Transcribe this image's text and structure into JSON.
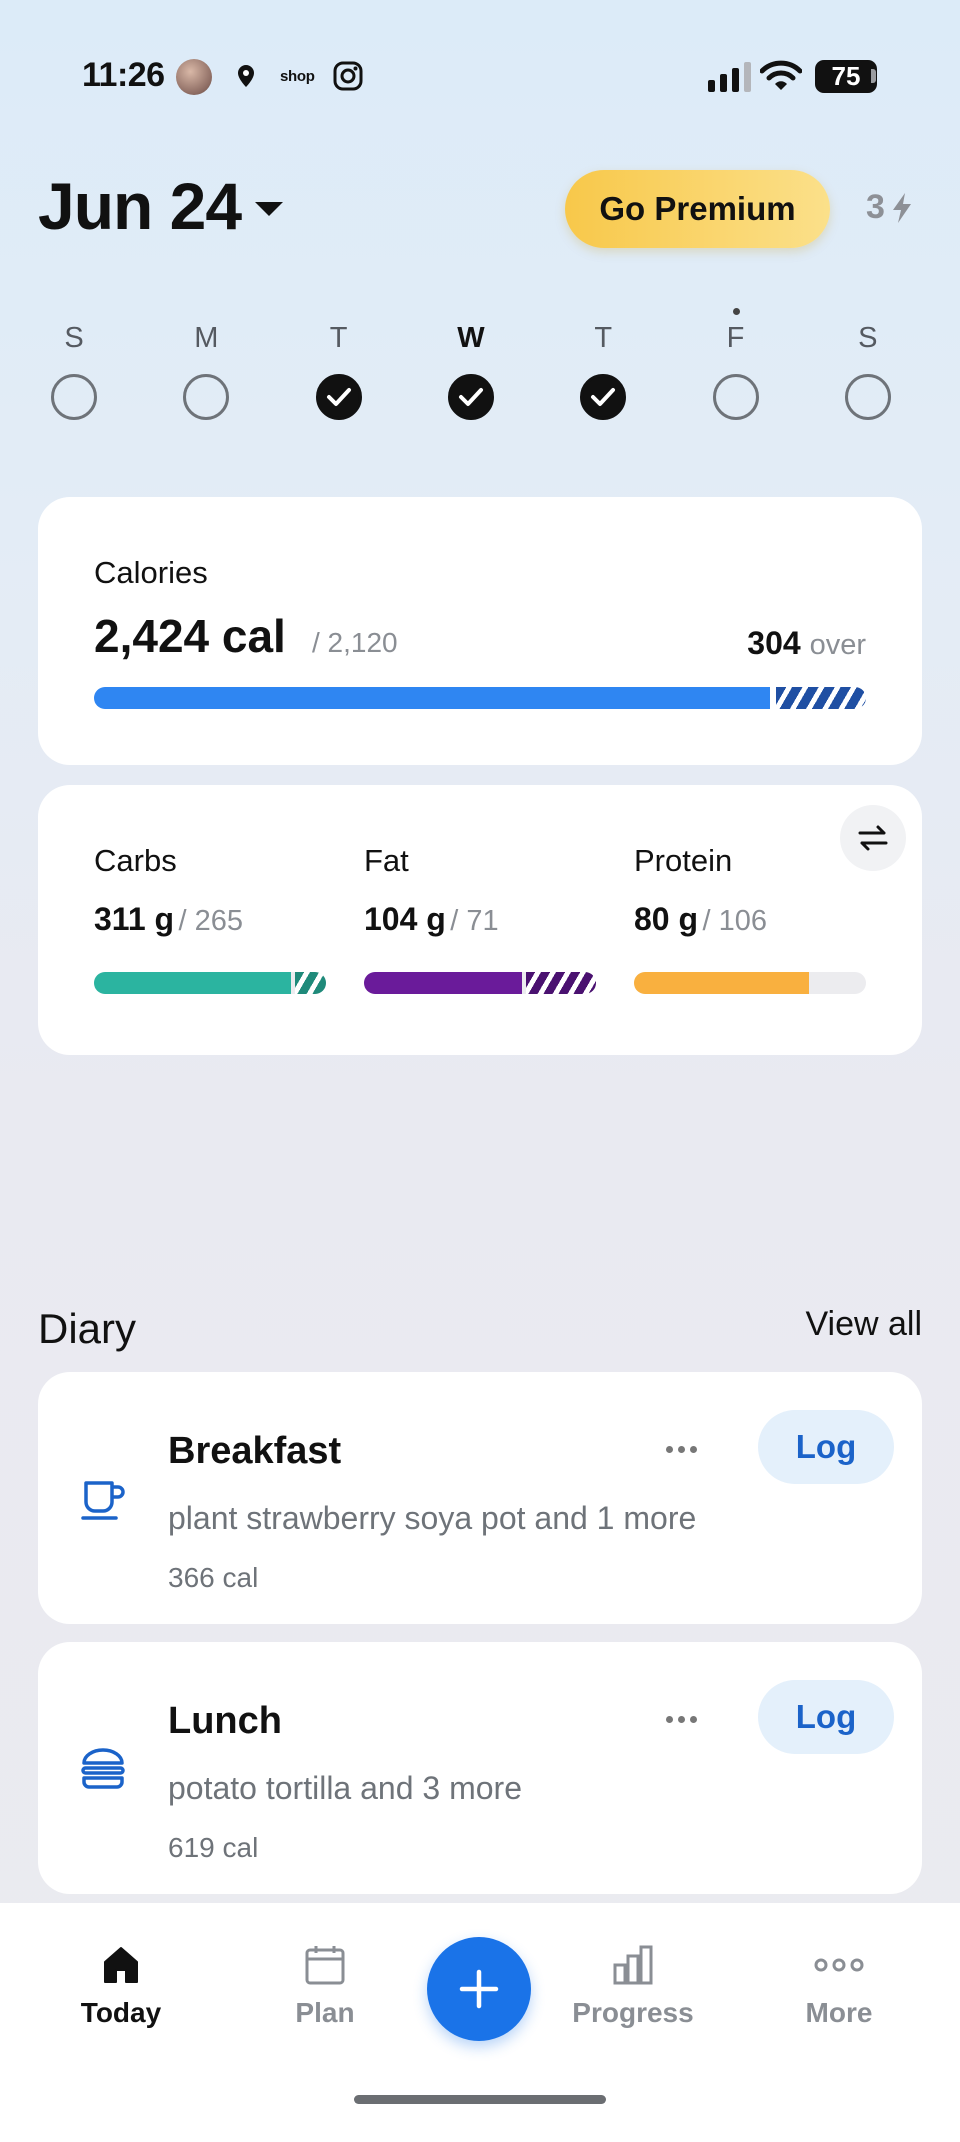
{
  "status_bar": {
    "time": "11:26",
    "shop_label": "shop",
    "battery": "75",
    "icons": [
      "avatar",
      "location-pin-icon",
      "shop-icon",
      "instagram-icon",
      "signal-icon",
      "wifi-icon",
      "battery-icon"
    ]
  },
  "header": {
    "date": "Jun 24",
    "premium_label": "Go Premium",
    "streak_count": "3",
    "premium_gradient": [
      "#f8c84a",
      "#fbe08a"
    ]
  },
  "week": {
    "days": [
      {
        "letter": "S",
        "checked": false,
        "today": false
      },
      {
        "letter": "M",
        "checked": false,
        "today": false
      },
      {
        "letter": "T",
        "checked": true,
        "today": false
      },
      {
        "letter": "W",
        "checked": true,
        "today": true
      },
      {
        "letter": "T",
        "checked": true,
        "today": false
      },
      {
        "letter": "F",
        "checked": false,
        "today": false,
        "dot": true
      },
      {
        "letter": "S",
        "checked": false,
        "today": false
      }
    ]
  },
  "calories": {
    "title": "Calories",
    "value": "2,424 cal",
    "goal": "/ 2,120",
    "over_amount": "304",
    "over_word": "over",
    "progress": 0.875,
    "color": "#2f86f2",
    "over_color": "#1f4fa3"
  },
  "macros": [
    {
      "name": "Carbs",
      "value": "311 g",
      "goal": "/ 265",
      "progress": 0.85,
      "over": true,
      "color": "#2bb4a0",
      "over_color": "#1f8a7a"
    },
    {
      "name": "Fat",
      "value": "104 g",
      "goal": "/ 71",
      "progress": 0.68,
      "over": true,
      "color": "#6a1b9a",
      "over_color": "#4a1170"
    },
    {
      "name": "Protein",
      "value": "80 g",
      "goal": "/ 106",
      "progress": 0.755,
      "over": false,
      "color": "#f9b03f"
    }
  ],
  "diary": {
    "title": "Diary",
    "view_all": "View all",
    "meals": [
      {
        "name": "Breakfast",
        "description": "plant strawberry soya pot and 1 more",
        "calories": "366 cal",
        "icon": "coffee-cup-icon",
        "log_label": "Log"
      },
      {
        "name": "Lunch",
        "description": "potato tortilla and 3 more",
        "calories": "619 cal",
        "icon": "burger-icon",
        "log_label": "Log"
      }
    ]
  },
  "nav": {
    "items": [
      {
        "label": "Today",
        "icon": "home-icon",
        "active": true
      },
      {
        "label": "Plan",
        "icon": "calendar-icon",
        "active": false
      },
      {
        "label": "Progress",
        "icon": "bar-chart-icon",
        "active": false
      },
      {
        "label": "More",
        "icon": "more-icon",
        "active": false
      }
    ],
    "fab_icon": "plus-icon",
    "accent": "#1a73e8"
  }
}
